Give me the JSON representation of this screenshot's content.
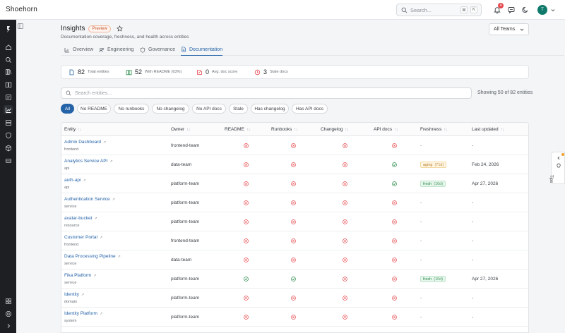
{
  "app": {
    "brand": "Shoehorn"
  },
  "topbar": {
    "search_placeholder": "Search...",
    "shortcut_keys": [
      "⌘",
      "K"
    ],
    "notification_count": "4",
    "avatar_initial": "T"
  },
  "page": {
    "title": "Insights",
    "preview_badge": "Preview",
    "subtitle": "Documentation coverage, freshness, and health across entities",
    "team_filter": "All Teams"
  },
  "tabs": [
    {
      "label": "Overview",
      "icon": "chart-icon"
    },
    {
      "label": "Engineering",
      "icon": "users-icon"
    },
    {
      "label": "Governance",
      "icon": "shield-icon"
    },
    {
      "label": "Documentation",
      "icon": "document-icon",
      "active": true
    }
  ],
  "stats": [
    {
      "value": "82",
      "label": "Total entities",
      "icon": "document-icon",
      "color": "#2563a8"
    },
    {
      "value": "52",
      "label": "With README (63%)",
      "icon": "book-icon",
      "color": "#2a8a4a"
    },
    {
      "value": "0",
      "label": "Avg. doc score",
      "icon": "score-icon",
      "color": "#e5484d"
    },
    {
      "value": "3",
      "label": "Stale docs",
      "icon": "clock-icon",
      "color": "#e5484d"
    }
  ],
  "entity_search": {
    "placeholder": "Search entities...",
    "showing": "Showing 50 of 82 entities"
  },
  "filters": [
    "All",
    "No README",
    "No runbooks",
    "No changelog",
    "No API docs",
    "Stale",
    "Has changelog",
    "Has API docs"
  ],
  "table": {
    "columns": [
      "Entity",
      "Owner",
      "README",
      "Runbooks",
      "Changelog",
      "API docs",
      "Freshness",
      "Last updated"
    ],
    "rows": [
      {
        "name": "Admin Dashboard",
        "type": "frontend",
        "owner": "frontend-team",
        "readme": false,
        "runbooks": false,
        "changelog": false,
        "api_docs": false,
        "freshness": "-",
        "freshness_days": "",
        "updated": "-"
      },
      {
        "name": "Analytics Service API",
        "type": "api",
        "owner": "data-team",
        "readme": false,
        "runbooks": false,
        "changelog": false,
        "api_docs": true,
        "freshness": "aging",
        "freshness_days": "(71d)",
        "updated": "Feb 24, 2026"
      },
      {
        "name": "auth-api",
        "type": "api",
        "owner": "platform-team",
        "readme": false,
        "runbooks": false,
        "changelog": false,
        "api_docs": true,
        "freshness": "fresh",
        "freshness_days": "(10d)",
        "updated": "Apr 27, 2026"
      },
      {
        "name": "Authentication Service",
        "type": "service",
        "owner": "platform-team",
        "readme": false,
        "runbooks": false,
        "changelog": false,
        "api_docs": false,
        "freshness": "-",
        "freshness_days": "",
        "updated": "-"
      },
      {
        "name": "avatar-bucket",
        "type": "resource",
        "owner": "platform-team",
        "readme": false,
        "runbooks": false,
        "changelog": false,
        "api_docs": false,
        "freshness": "-",
        "freshness_days": "",
        "updated": "-"
      },
      {
        "name": "Customer Portal",
        "type": "frontend",
        "owner": "frontend-team",
        "readme": false,
        "runbooks": false,
        "changelog": false,
        "api_docs": false,
        "freshness": "-",
        "freshness_days": "",
        "updated": "-"
      },
      {
        "name": "Data Processing Pipeline",
        "type": "service",
        "owner": "data-team",
        "readme": false,
        "runbooks": false,
        "changelog": false,
        "api_docs": false,
        "freshness": "-",
        "freshness_days": "",
        "updated": "-"
      },
      {
        "name": "Fika Platform",
        "type": "service",
        "owner": "platform-team",
        "readme": true,
        "runbooks": true,
        "changelog": false,
        "api_docs": false,
        "freshness": "fresh",
        "freshness_days": "(10d)",
        "updated": "Apr 27, 2026"
      },
      {
        "name": "Identity",
        "type": "domain",
        "owner": "platform-team",
        "readme": false,
        "runbooks": false,
        "changelog": false,
        "api_docs": false,
        "freshness": "-",
        "freshness_days": "",
        "updated": "-"
      },
      {
        "name": "Identity Platform",
        "type": "system",
        "owner": "platform-team",
        "readme": false,
        "runbooks": false,
        "changelog": false,
        "api_docs": false,
        "freshness": "-",
        "freshness_days": "",
        "updated": "-"
      }
    ]
  },
  "tips": {
    "label": "Tips"
  },
  "colors": {
    "accent": "#2563a8",
    "ok": "#2a8a4a",
    "bad": "#e5484d",
    "rail": "#1d1f22"
  }
}
